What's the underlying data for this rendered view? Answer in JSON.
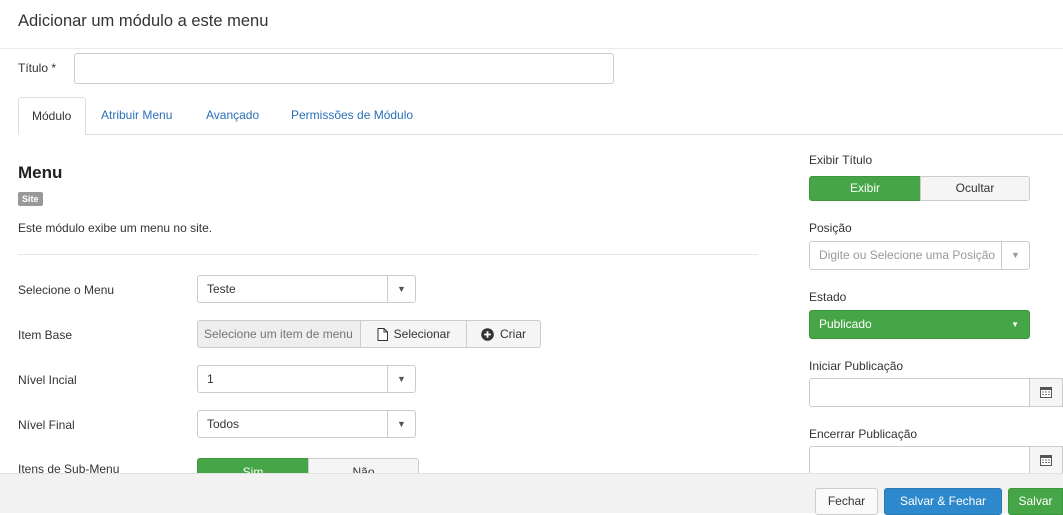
{
  "page": {
    "title": "Adicionar um módulo a este menu"
  },
  "title_field": {
    "label": "Título *",
    "value": ""
  },
  "tabs": [
    {
      "label": "Módulo",
      "active": true
    },
    {
      "label": "Atribuir Menu"
    },
    {
      "label": "Avançado"
    },
    {
      "label": "Permissões de Módulo"
    }
  ],
  "module": {
    "name": "Menu",
    "badge": "Site",
    "description": "Este módulo exibe um menu no site."
  },
  "fields": {
    "menu": {
      "label": "Selecione o Menu",
      "value": "Teste"
    },
    "base_item": {
      "label": "Item Base",
      "placeholder": "Selecione um item de menu",
      "select_label": "Selecionar",
      "create_label": "Criar"
    },
    "start_level": {
      "label": "Nível Incial",
      "value": "1"
    },
    "end_level": {
      "label": "Nível Final",
      "value": "Todos"
    },
    "submenu": {
      "label": "Itens de Sub-Menu",
      "yes": "Sim",
      "no": "Não"
    }
  },
  "sidebar": {
    "show_title": {
      "label": "Exibir Título",
      "show": "Exibir",
      "hide": "Ocultar"
    },
    "position": {
      "label": "Posição",
      "placeholder": "Digite ou Selecione uma Posição"
    },
    "status": {
      "label": "Estado",
      "value": "Publicado"
    },
    "publish_up": {
      "label": "Iniciar Publicação",
      "value": ""
    },
    "publish_down": {
      "label": "Encerrar Publicação",
      "value": ""
    }
  },
  "footer": {
    "close": "Fechar",
    "save_close": "Salvar & Fechar",
    "save": "Salvar"
  },
  "colors": {
    "green": "#46a546",
    "blue": "#2e89cc",
    "link": "#2a70b8"
  }
}
